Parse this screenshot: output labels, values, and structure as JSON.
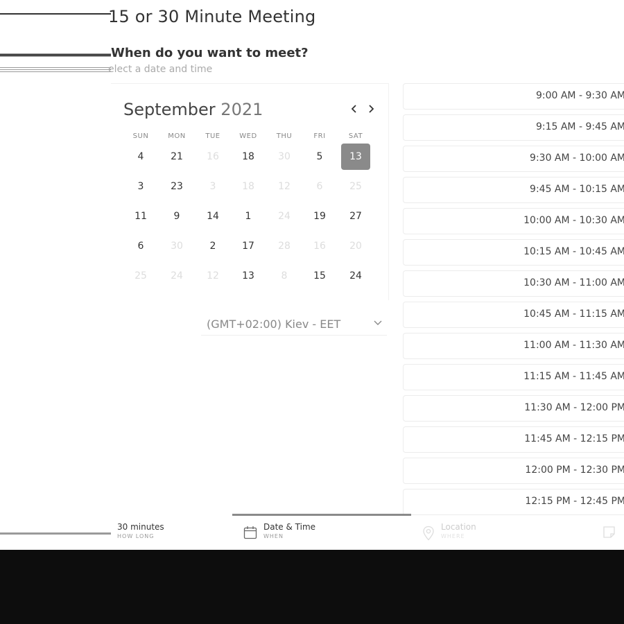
{
  "header": {
    "title": "15 or 30 Minute Meeting",
    "subtitle": "When do you want to meet?",
    "hint": "elect a date and time"
  },
  "calendar": {
    "month": "September",
    "year": "2021",
    "weekdays": [
      "SUN",
      "MON",
      "TUE",
      "WED",
      "THU",
      "FRI",
      "SAT"
    ],
    "weeks": [
      [
        {
          "d": "4"
        },
        {
          "d": "21"
        },
        {
          "d": "16",
          "off": true
        },
        {
          "d": "18"
        },
        {
          "d": "30",
          "off": true
        },
        {
          "d": "5"
        },
        {
          "d": "13",
          "sel": true
        }
      ],
      [
        {
          "d": "3"
        },
        {
          "d": "23"
        },
        {
          "d": "3",
          "off": true
        },
        {
          "d": "18",
          "off": true
        },
        {
          "d": "12",
          "off": true
        },
        {
          "d": "6",
          "off": true
        },
        {
          "d": "25",
          "off": true
        }
      ],
      [
        {
          "d": "11"
        },
        {
          "d": "9"
        },
        {
          "d": "14"
        },
        {
          "d": "1"
        },
        {
          "d": "24",
          "off": true
        },
        {
          "d": "19"
        },
        {
          "d": "27"
        }
      ],
      [
        {
          "d": "6"
        },
        {
          "d": "30",
          "off": true
        },
        {
          "d": "2"
        },
        {
          "d": "17"
        },
        {
          "d": "28",
          "off": true
        },
        {
          "d": "16",
          "off": true
        },
        {
          "d": "20",
          "off": true
        }
      ],
      [
        {
          "d": "25",
          "off": true
        },
        {
          "d": "24",
          "off": true
        },
        {
          "d": "12",
          "off": true
        },
        {
          "d": "13"
        },
        {
          "d": "8",
          "off": true
        },
        {
          "d": "15"
        },
        {
          "d": "24"
        }
      ]
    ],
    "prev_icon": "chevron-left-icon",
    "next_icon": "chevron-right-icon",
    "selected_color": "#8a8a8a"
  },
  "timezone": {
    "label": "(GMT+02:00) Kiev - EET",
    "icon": "chevron-down-icon"
  },
  "slots": [
    "9:00 AM - 9:30 AM",
    "9:15 AM - 9:45 AM",
    "9:30 AM - 10:00 AM",
    "9:45 AM - 10:15 AM",
    "10:00 AM - 10:30 AM",
    "10:15 AM - 10:45 AM",
    "10:30 AM - 11:00 AM",
    "10:45 AM - 11:15 AM",
    "11:00 AM - 11:30 AM",
    "11:15 AM - 11:45 AM",
    "11:30 AM - 12:00 PM",
    "11:45 AM - 12:15 PM",
    "12:00 PM - 12:30 PM",
    "12:15 PM - 12:45 PM"
  ],
  "steps": [
    {
      "label": "30 minutes",
      "sub": "HOW LONG"
    },
    {
      "label": "Date & Time",
      "sub": "WHEN",
      "icon": "calendar-icon"
    },
    {
      "label": "Location",
      "sub": "WHERE",
      "icon": "location-pin-icon"
    },
    {
      "label": "",
      "sub": "",
      "icon": "note-icon"
    }
  ]
}
